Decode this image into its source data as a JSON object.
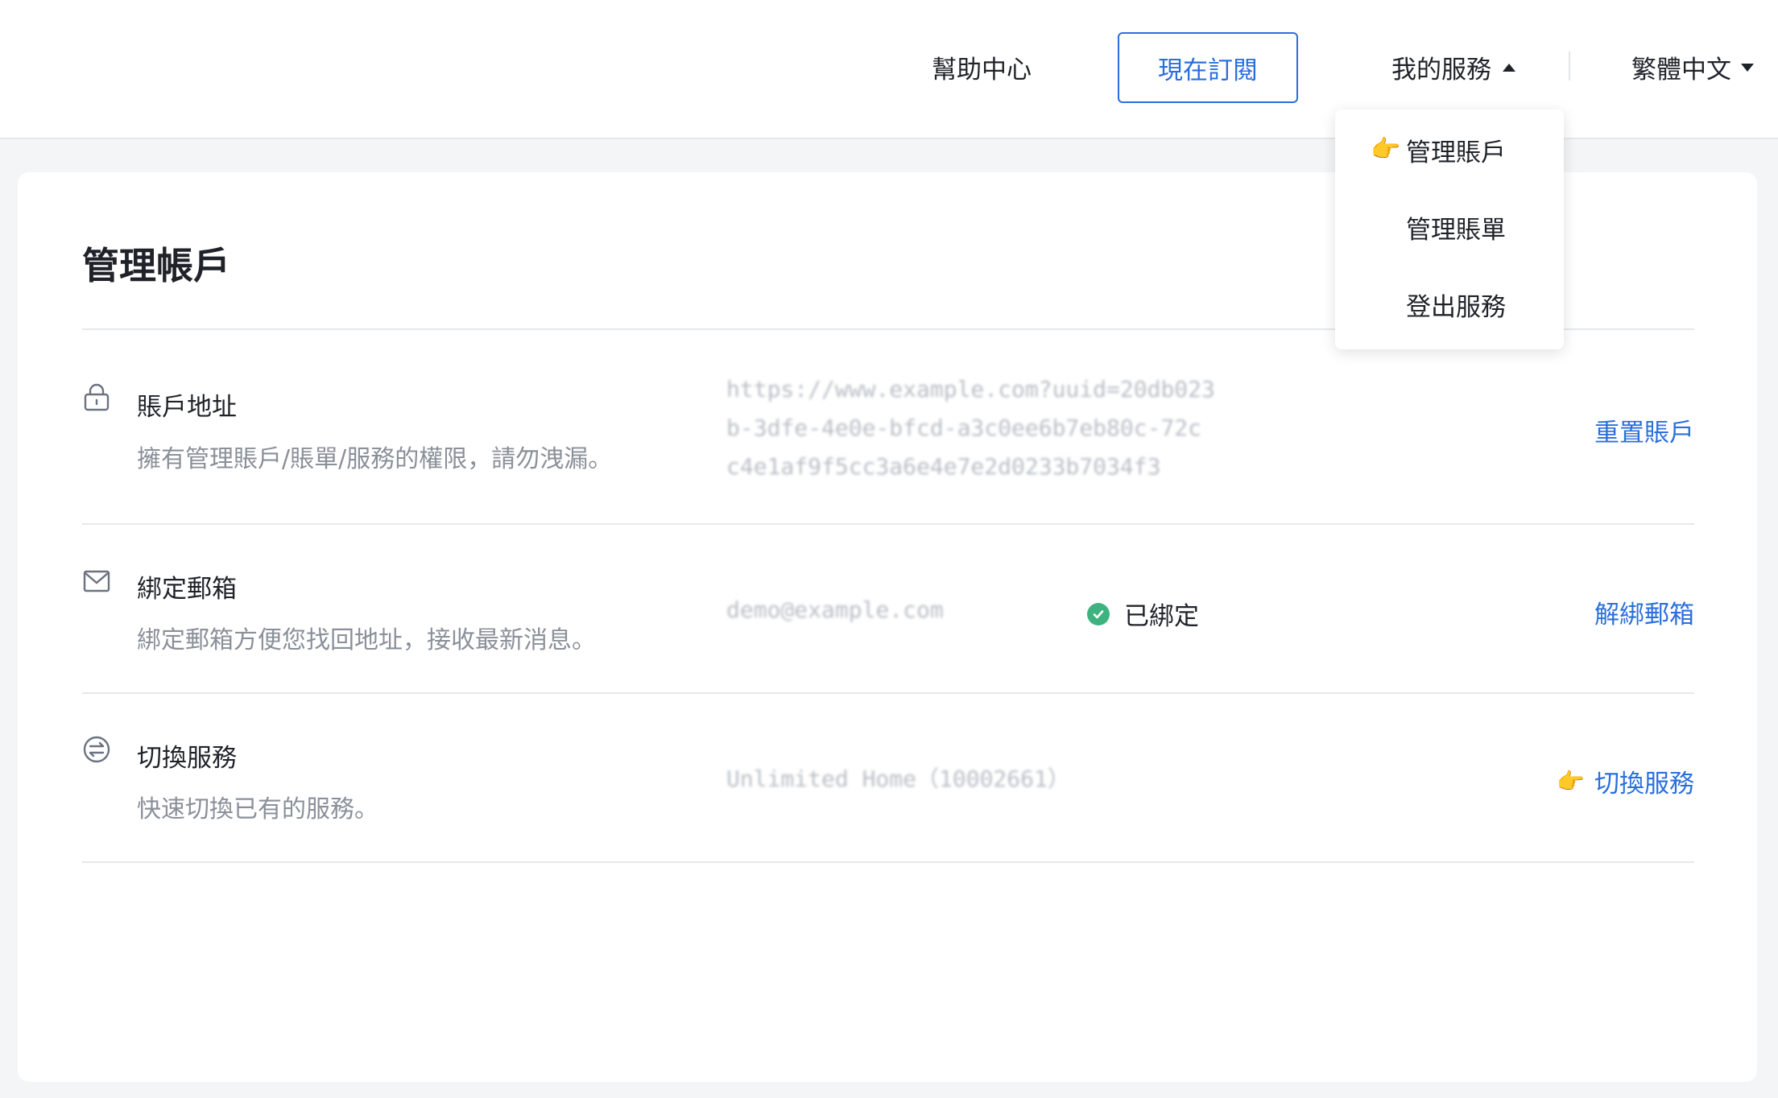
{
  "header": {
    "help": "幫助中心",
    "subscribe": "現在訂閱",
    "my_services": "我的服務",
    "language": "繁體中文"
  },
  "dropdown": {
    "items": [
      {
        "label": "管理賬戶",
        "pointer": "👉"
      },
      {
        "label": "管理賬單"
      },
      {
        "label": "登出服務"
      }
    ]
  },
  "page": {
    "title": "管理帳戶"
  },
  "rows": [
    {
      "icon": "lock-icon",
      "title": "賬戶地址",
      "desc": "擁有管理賬戶/賬單/服務的權限，請勿洩漏。",
      "value_lines": [
        "https://www.example.com?uuid=20db023",
        "b-3dfe-4e0e-bfcd-a3c0ee6b7eb80c-72c",
        "c4e1af9f5cc3a6e4e7e2d0233b7034f3"
      ],
      "action": "重置賬戶"
    },
    {
      "icon": "mail-icon",
      "title": "綁定郵箱",
      "desc": "綁定郵箱方便您找回地址，接收最新消息。",
      "value": "demo@example.com",
      "status": "已綁定",
      "action": "解綁郵箱"
    },
    {
      "icon": "switch-icon",
      "title": "切換服務",
      "desc": "快速切換已有的服務。",
      "value": "Unlimited Home（10002661）",
      "action": "切換服務",
      "action_pointer": "👉"
    }
  ],
  "colors": {
    "accent": "#2b6fdc",
    "success": "#3fb37f",
    "muted": "#8a9099"
  }
}
